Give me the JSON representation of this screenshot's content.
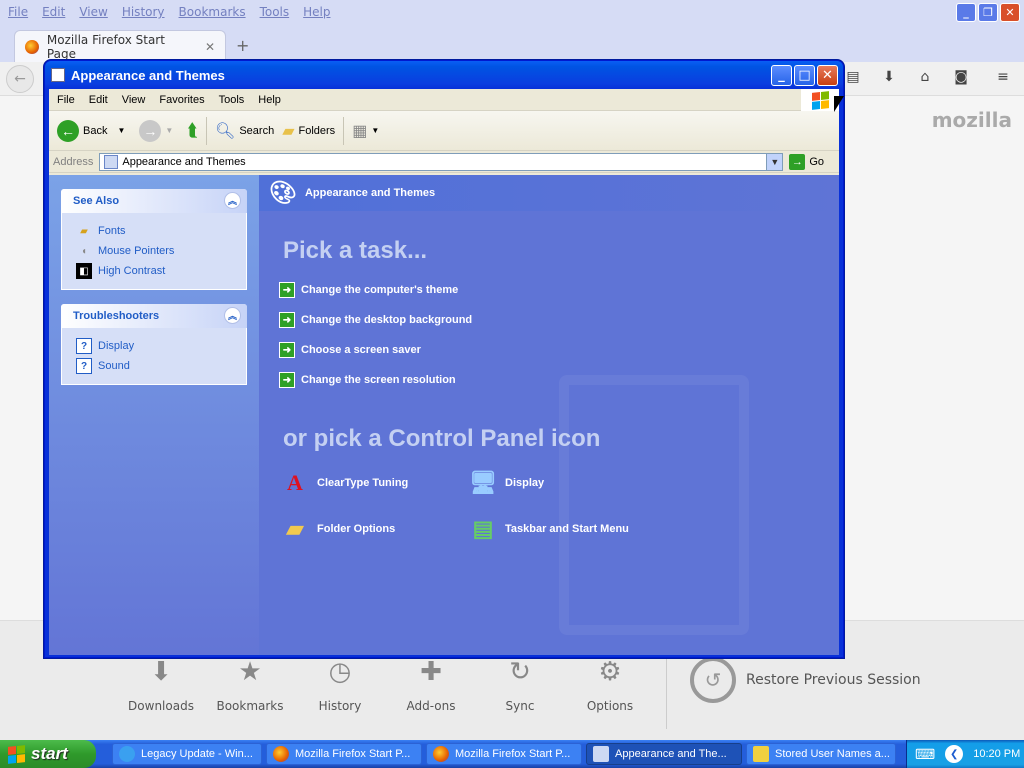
{
  "firefox": {
    "menu": [
      "File",
      "Edit",
      "View",
      "History",
      "Bookmarks",
      "Tools",
      "Help"
    ],
    "tab_title": "Mozilla Firefox Start Page",
    "brand": "mozilla",
    "launchers": [
      {
        "label": "Downloads",
        "icon": "download-icon"
      },
      {
        "label": "Bookmarks",
        "icon": "star-icon"
      },
      {
        "label": "History",
        "icon": "clock-icon"
      },
      {
        "label": "Add-ons",
        "icon": "puzzle-icon"
      },
      {
        "label": "Sync",
        "icon": "sync-icon"
      },
      {
        "label": "Options",
        "icon": "gear-icon"
      }
    ],
    "restore_label": "Restore Previous Session"
  },
  "explorer": {
    "title": "Appearance and Themes",
    "menu": [
      "File",
      "Edit",
      "View",
      "Favorites",
      "Tools",
      "Help"
    ],
    "toolbar": {
      "back": "Back",
      "search": "Search",
      "folders": "Folders"
    },
    "address": {
      "label": "Address",
      "value": "Appearance and Themes",
      "go": "Go"
    },
    "see_also": {
      "title": "See Also",
      "items": [
        {
          "label": "Fonts",
          "icon": "fonts-folder-icon"
        },
        {
          "label": "Mouse Pointers",
          "icon": "mouse-icon"
        },
        {
          "label": "High Contrast",
          "icon": "high-contrast-icon"
        }
      ]
    },
    "troubleshooters": {
      "title": "Troubleshooters",
      "items": [
        {
          "label": "Display",
          "icon": "help-icon"
        },
        {
          "label": "Sound",
          "icon": "help-icon"
        }
      ]
    },
    "header": "Appearance and Themes",
    "pick_task": "Pick a task...",
    "tasks": [
      "Change the computer's theme",
      "Change the desktop background",
      "Choose a screen saver",
      "Change the screen resolution"
    ],
    "or_pick": "or pick a Control Panel icon",
    "icons": [
      {
        "label": "ClearType Tuning",
        "icon": "cleartype-icon"
      },
      {
        "label": "Display",
        "icon": "display-icon"
      },
      {
        "label": "Folder Options",
        "icon": "folder-options-icon"
      },
      {
        "label": "Taskbar and Start Menu",
        "icon": "taskbar-icon"
      }
    ]
  },
  "taskbar": {
    "start": "start",
    "buttons": [
      {
        "label": "Legacy Update - Win...",
        "icon": "ie-icon"
      },
      {
        "label": "Mozilla Firefox Start P...",
        "icon": "firefox-icon"
      },
      {
        "label": "Mozilla Firefox Start P...",
        "icon": "firefox-icon"
      },
      {
        "label": "Appearance and The...",
        "icon": "control-panel-icon"
      },
      {
        "label": "Stored User Names a...",
        "icon": "key-icon"
      }
    ],
    "clock": "10:20 PM"
  },
  "colors": {
    "xp_blue": "#0831d9",
    "task_bg": "#5f74d6",
    "start_green": "#2f9a2b",
    "link": "#215dc6"
  }
}
